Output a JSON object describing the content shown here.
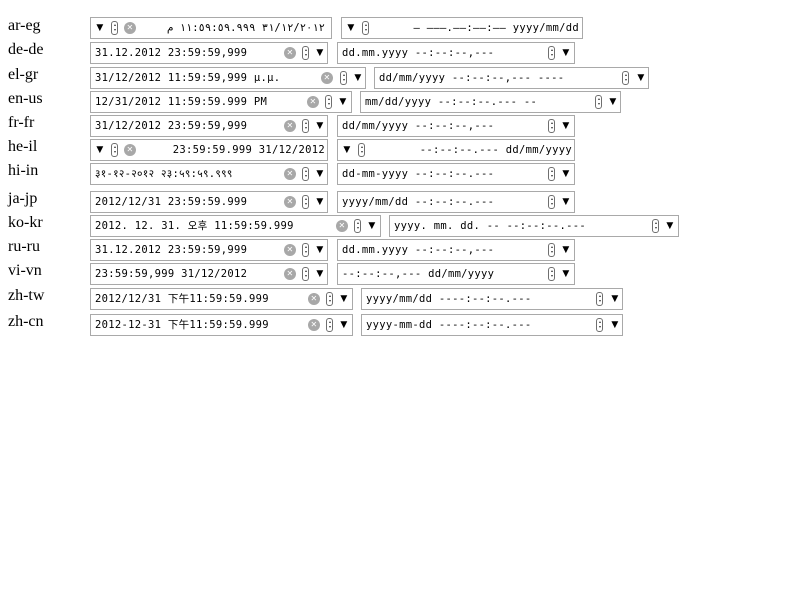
{
  "rows": [
    {
      "locale": "ar-eg",
      "first": "٣١/١٢/٢٠١٢ ١١:٥٩:٥٩.٩٩٩ م",
      "second": "yyyy/mm/dd ––:––:––.––– –"
    },
    {
      "locale": "de-de",
      "first": "31.12.2012 23:59:59,999",
      "second": "dd.mm.yyyy --:--:--,---"
    },
    {
      "locale": "el-gr",
      "first": "31/12/2012 11:59:59,999 μ.μ.",
      "second": "dd/mm/yyyy --:--:--,--- ----"
    },
    {
      "locale": "en-us",
      "first": "12/31/2012 11:59:59.999 PM",
      "second": "mm/dd/yyyy --:--:--.--- --"
    },
    {
      "locale": "fr-fr",
      "first": "31/12/2012 23:59:59,999",
      "second": "dd/mm/yyyy --:--:--,---"
    },
    {
      "locale": "he-il",
      "first": "23:59:59.999 31/12/2012",
      "second": "--:--:--.--- dd/mm/yyyy"
    },
    {
      "locale": "hi-in",
      "first": "३१-१२-२०१२ २३:५९:५९.९९९",
      "second": "dd-mm-yyyy --:--:--.---"
    },
    {
      "locale": "ja-jp",
      "first": "2012/12/31 23:59:59.999",
      "second": "yyyy/mm/dd --:--:--.---"
    },
    {
      "locale": "ko-kr",
      "first": "2012. 12. 31. 오후 11:59:59.999",
      "second": "yyyy. mm. dd. -- --:--:--.---"
    },
    {
      "locale": "ru-ru",
      "first": "31.12.2012 23:59:59,999",
      "second": "dd.mm.yyyy --:--:--,---"
    },
    {
      "locale": "vi-vn",
      "first": "23:59:59,999 31/12/2012",
      "second": "--:--:--,--- dd/mm/yyyy"
    },
    {
      "locale": "zh-tw",
      "first": "2012/12/31 下午11:59:59.999",
      "second": "yyyy/mm/dd ----:--:--.---"
    },
    {
      "locale": "zh-cn",
      "first": "2012-12-31 下午11:59:59.999",
      "second": "yyyy-mm-dd ----:--:--.---"
    }
  ],
  "icons": {
    "clear": "clear-icon",
    "spinner": "spin-button-icon",
    "dropdown": "dropdown-arrow-icon",
    "clear_glyph": "✕",
    "dropdown_glyph": "▼"
  }
}
